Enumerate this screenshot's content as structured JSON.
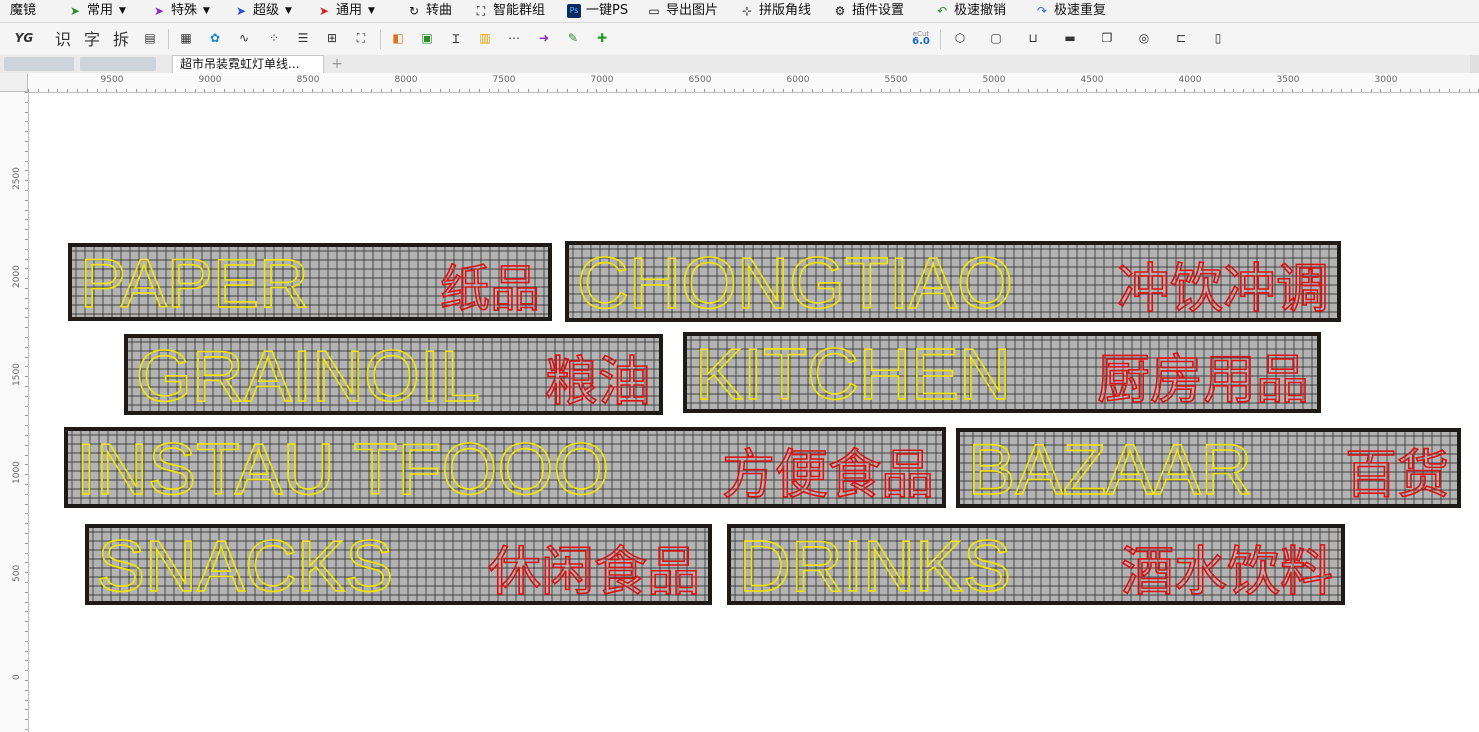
{
  "menubar": {
    "items": [
      {
        "label": "魔镜",
        "icon": "",
        "dropdown": false
      },
      {
        "label": "常用",
        "icon": "arrow-icon",
        "dropdown": true
      },
      {
        "label": "特殊",
        "icon": "arrow-icon",
        "dropdown": true
      },
      {
        "label": "超级",
        "icon": "arrow-icon",
        "dropdown": true
      },
      {
        "label": "通用",
        "icon": "arrow-icon",
        "dropdown": true
      },
      {
        "label": "转曲",
        "icon": "curve-icon",
        "dropdown": false
      },
      {
        "label": "智能群组",
        "icon": "group-icon",
        "dropdown": false
      },
      {
        "label": "一键PS",
        "icon": "ps-icon",
        "dropdown": false
      },
      {
        "label": "导出图片",
        "icon": "image-icon",
        "dropdown": false
      },
      {
        "label": "拼版角线",
        "icon": "crop-icon",
        "dropdown": false
      },
      {
        "label": "插件设置",
        "icon": "gear-icon",
        "dropdown": false
      },
      {
        "label": "极速撤销",
        "icon": "undo-icon",
        "dropdown": false
      },
      {
        "label": "极速重复",
        "icon": "redo-icon",
        "dropdown": false
      }
    ]
  },
  "toolbar": {
    "text_buttons": [
      "YG",
      "识",
      "字",
      "拆"
    ],
    "badge": {
      "top": "eCut",
      "bottom": "6.0"
    }
  },
  "tabs": {
    "active_document": "超市吊装霓虹灯单线...",
    "add_tab": "+"
  },
  "ruler": {
    "top_labels": [
      "9500",
      "9000",
      "8500",
      "8000",
      "7500",
      "7000",
      "6500",
      "6000",
      "5500",
      "5000",
      "4500",
      "4000",
      "3500",
      "3000"
    ],
    "left_labels": [
      "2500",
      "2000",
      "1500",
      "1000",
      "500",
      "0"
    ]
  },
  "signs": [
    {
      "english": "PAPER",
      "chinese": "纸品"
    },
    {
      "english": "CHONGTIAO",
      "chinese": "冲饮冲调"
    },
    {
      "english": "GRAINOIL",
      "chinese": "粮油"
    },
    {
      "english": "KITCHEN",
      "chinese": "厨房用品"
    },
    {
      "english": "INSTAU TFOOO",
      "chinese": "方便食品"
    },
    {
      "english": "BAZAAR",
      "chinese": "百货"
    },
    {
      "english": "SNACKS",
      "chinese": "休闲食品"
    },
    {
      "english": "DRINKS",
      "chinese": "酒水饮料"
    }
  ],
  "colors": {
    "english_outline": "#f2e600",
    "chinese_outline": "#e01010",
    "sign_frame": "#1e1a18",
    "sign_fill": "#b3b3b3",
    "grid": "#222222"
  }
}
